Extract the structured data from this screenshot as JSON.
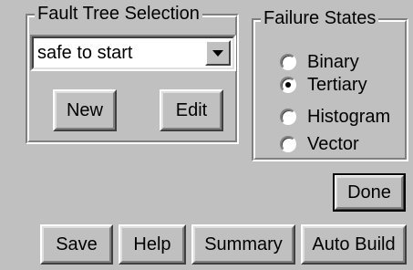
{
  "fault_tree": {
    "legend": "Fault Tree Selection",
    "selected": "safe to start",
    "new_label": "New",
    "edit_label": "Edit"
  },
  "failure_states": {
    "legend": "Failure States",
    "options": [
      {
        "label": "Binary",
        "checked": false
      },
      {
        "label": "Tertiary",
        "checked": true
      },
      {
        "label": "Histogram",
        "checked": false
      },
      {
        "label": "Vector",
        "checked": false
      }
    ]
  },
  "actions": {
    "done_label": "Done",
    "save_label": "Save",
    "help_label": "Help",
    "summary_label": "Summary",
    "auto_build_label": "Auto Build"
  },
  "icons": {
    "dropdown": "chevron-down-icon"
  },
  "colors": {
    "face": "#c0c0c0",
    "highlight": "#ffffff",
    "shadow": "#808080",
    "dark_shadow": "#404040"
  }
}
